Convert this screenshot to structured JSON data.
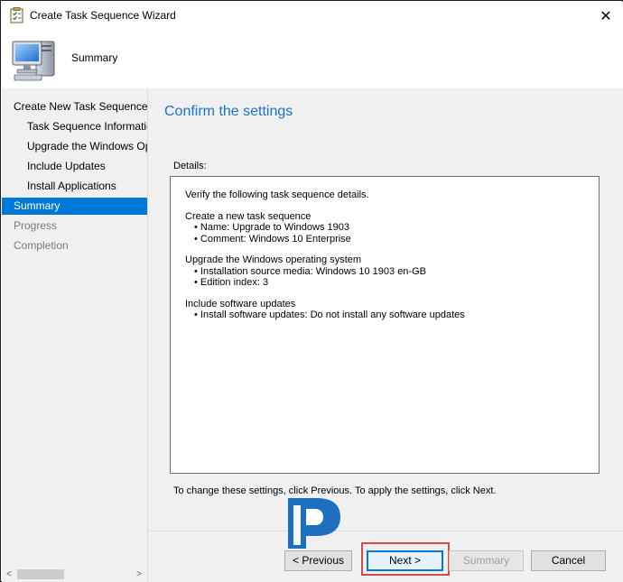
{
  "window": {
    "title": "Create Task Sequence Wizard",
    "close_glyph": "✕"
  },
  "header": {
    "title": "Summary",
    "icon": "computer-icon"
  },
  "nav": {
    "items": [
      {
        "label": "Create New Task Sequence",
        "level": 0,
        "state": "normal"
      },
      {
        "label": "Task Sequence Information",
        "level": 1,
        "state": "normal"
      },
      {
        "label": "Upgrade the Windows Operating System",
        "level": 1,
        "state": "normal"
      },
      {
        "label": "Include Updates",
        "level": 1,
        "state": "normal"
      },
      {
        "label": "Install Applications",
        "level": 1,
        "state": "normal"
      },
      {
        "label": "Summary",
        "level": 0,
        "state": "active"
      },
      {
        "label": "Progress",
        "level": 0,
        "state": "dim"
      },
      {
        "label": "Completion",
        "level": 0,
        "state": "dim"
      }
    ],
    "scroll_left": "<",
    "scroll_right": ">"
  },
  "content": {
    "title": "Confirm the settings",
    "details_label": "Details:",
    "details": {
      "intro": "Verify the following task sequence details.",
      "section1_heading": "Create a new task sequence",
      "section1_name": "•  Name: Upgrade to Windows 1903",
      "section1_comment": "•  Comment: Windows 10 Enterprise",
      "section2_heading": "Upgrade the Windows operating system",
      "section2_source": "•  Installation source media:  Windows 10 1903  en-GB",
      "section2_edition": "•  Edition index: 3",
      "section3_heading": "Include software updates",
      "section3_install": "•  Install software updates: Do not install any software updates"
    },
    "footnote": "To change these settings, click Previous. To apply the settings, click Next."
  },
  "buttons": {
    "previous": "< Previous",
    "next": "Next >",
    "summary": "Summary",
    "cancel": "Cancel"
  },
  "colors": {
    "accent": "#0078d7",
    "title_blue": "#1a73c6",
    "highlight": "#d44a4a"
  }
}
